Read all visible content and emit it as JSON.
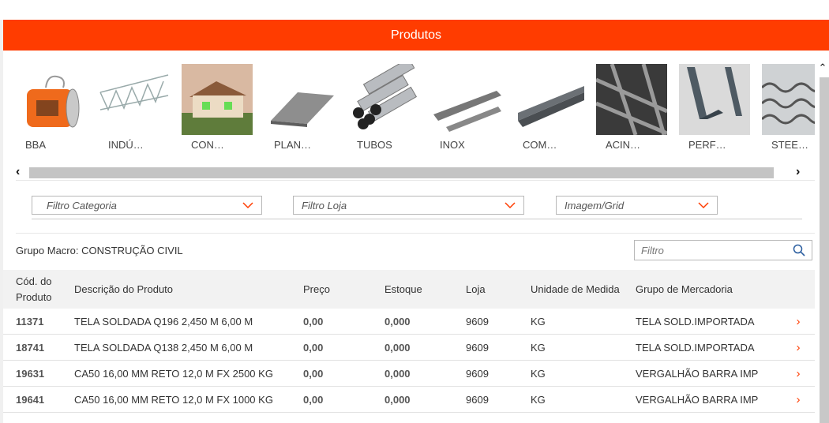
{
  "header": {
    "title": "Produtos"
  },
  "categories": [
    {
      "label": "BBA",
      "icon": "barbed-wire-coil"
    },
    {
      "label": "INDÚ…",
      "icon": "lattice-truss"
    },
    {
      "label": "CON…",
      "icon": "house"
    },
    {
      "label": "PLAN…",
      "icon": "metal-sheet"
    },
    {
      "label": "TUBOS",
      "icon": "tubes"
    },
    {
      "label": "INOX",
      "icon": "steel-bars"
    },
    {
      "label": "COM…",
      "icon": "channel-profile"
    },
    {
      "label": "ACIN…",
      "icon": "rebar-mesh"
    },
    {
      "label": "PERF…",
      "icon": "angle-profile"
    },
    {
      "label": "STEE…",
      "icon": "roofing-sheet"
    }
  ],
  "filters": {
    "categoria": "Filtro Categoria",
    "loja": "Filtro Loja",
    "view": "Imagem/Grid"
  },
  "group": {
    "label": "Grupo Macro: CONSTRUÇÃO CIVIL"
  },
  "search": {
    "placeholder": "Filtro"
  },
  "table": {
    "headers": [
      "Cód. do Produto",
      "Descrição do Produto",
      "Preço",
      "Estoque",
      "Loja",
      "Unidade de Medida",
      "Grupo de Mercadoria"
    ],
    "rows": [
      {
        "code": "11371",
        "desc": "TELA SOLDADA Q196 2,450 M 6,00 M",
        "price": "0,00",
        "stock": "0,000",
        "store": "9609",
        "unit": "KG",
        "group": "TELA SOLD.IMPORTADA"
      },
      {
        "code": "18741",
        "desc": "TELA SOLDADA Q138 2,450 M 6,00 M",
        "price": "0,00",
        "stock": "0,000",
        "store": "9609",
        "unit": "KG",
        "group": "TELA SOLD.IMPORTADA"
      },
      {
        "code": "19631",
        "desc": "CA50 16,00 MM RETO 12,0 M FX 2500 KG",
        "price": "0,00",
        "stock": "0,000",
        "store": "9609",
        "unit": "KG",
        "group": "VERGALHÃO BARRA IMP"
      },
      {
        "code": "19641",
        "desc": "CA50 16,00 MM RETO 12,0 M FX 1000 KG",
        "price": "0,00",
        "stock": "0,000",
        "store": "9609",
        "unit": "KG",
        "group": "VERGALHÃO BARRA IMP"
      }
    ]
  },
  "colors": {
    "accent": "#ff3c00"
  }
}
